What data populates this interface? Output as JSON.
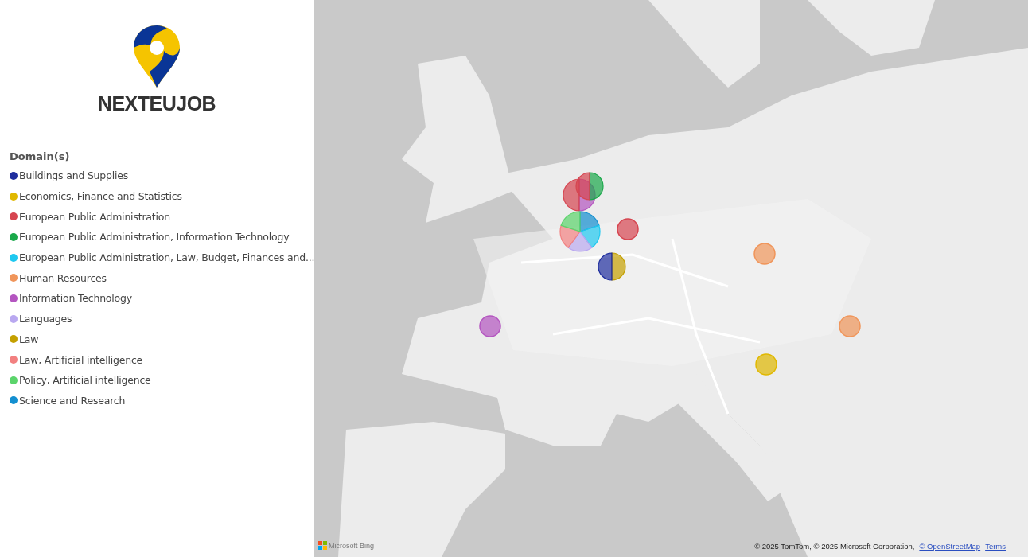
{
  "brand": {
    "name": "NEXTEUJOB"
  },
  "legend": {
    "title": "Domain(s)",
    "items": [
      {
        "label": "Buildings and Supplies",
        "color": "#1f2e9e"
      },
      {
        "label": "Economics, Finance and Statistics",
        "color": "#e0b800"
      },
      {
        "label": "European Public Administration",
        "color": "#d64550"
      },
      {
        "label": "European Public Administration, Information Technology",
        "color": "#1aa84a"
      },
      {
        "label": "European Public Administration, Law, Budget, Finances and...",
        "color": "#1ec8f0"
      },
      {
        "label": "Human Resources",
        "color": "#f0955a"
      },
      {
        "label": "Information Technology",
        "color": "#b455c0"
      },
      {
        "label": "Languages",
        "color": "#b9a8f0"
      },
      {
        "label": "Law",
        "color": "#c4a000"
      },
      {
        "label": "Law, Artificial intelligence",
        "color": "#f28080"
      },
      {
        "label": "Policy, Artificial intelligence",
        "color": "#5bd46b"
      },
      {
        "label": "Science and Research",
        "color": "#138fd0"
      }
    ]
  },
  "map": {
    "kind": "picture",
    "markers": [
      {
        "slices": [
          {
            "color": "#b455c0"
          },
          {
            "color": "#d64550"
          }
        ]
      },
      {
        "slices": [
          {
            "color": "#1aa84a"
          },
          {
            "color": "#d64550"
          }
        ]
      },
      {
        "slices": [
          {
            "color": "#138fd0"
          },
          {
            "color": "#1ec8f0"
          },
          {
            "color": "#b9a8f0"
          },
          {
            "color": "#f28080"
          },
          {
            "color": "#5bd46b"
          }
        ]
      },
      {
        "slices": [
          {
            "color": "#d64550"
          }
        ]
      },
      {
        "slices": [
          {
            "color": "#c4a000"
          },
          {
            "color": "#1f2e9e"
          }
        ]
      },
      {
        "slices": [
          {
            "color": "#f0955a"
          }
        ]
      },
      {
        "slices": [
          {
            "color": "#f0955a"
          }
        ]
      },
      {
        "slices": [
          {
            "color": "#e0b800"
          }
        ]
      },
      {
        "slices": [
          {
            "color": "#b455c0"
          }
        ]
      }
    ],
    "provider": "Microsoft Bing",
    "attribution": "© 2025 TomTom, © 2025 Microsoft Corporation,",
    "links": [
      "© OpenStreetMap",
      "Terms"
    ]
  }
}
